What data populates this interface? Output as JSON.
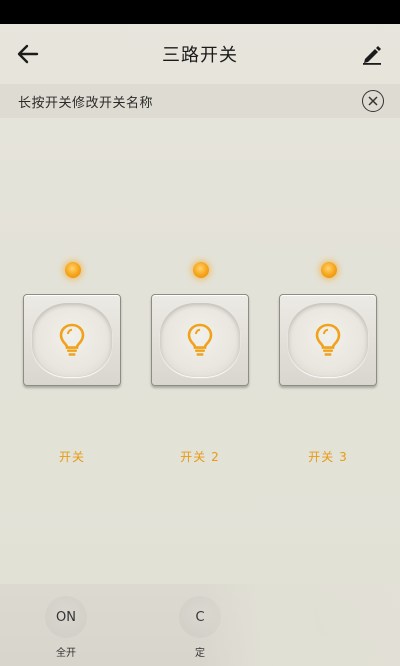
{
  "header": {
    "title": "三路开关",
    "back_icon": "arrow-left-icon",
    "edit_icon": "pencil-icon"
  },
  "hint": {
    "text": "长按开关修改开关名称",
    "close_icon": "close-circle-icon"
  },
  "switches": [
    {
      "label": "开关",
      "icon": "lightbulb-icon",
      "state_on": true
    },
    {
      "label": "开关 2",
      "icon": "lightbulb-icon",
      "state_on": true
    },
    {
      "label": "开关 3",
      "icon": "lightbulb-icon",
      "state_on": true
    }
  ],
  "bottom": {
    "items": [
      {
        "circle_text": "ON",
        "label": "全开"
      },
      {
        "circle_text": "C",
        "label": "定"
      },
      {
        "circle_text": "",
        "label": ""
      }
    ]
  },
  "colors": {
    "accent": "#e99a14",
    "led": "#f5a318",
    "background": "#e3e2d8"
  }
}
